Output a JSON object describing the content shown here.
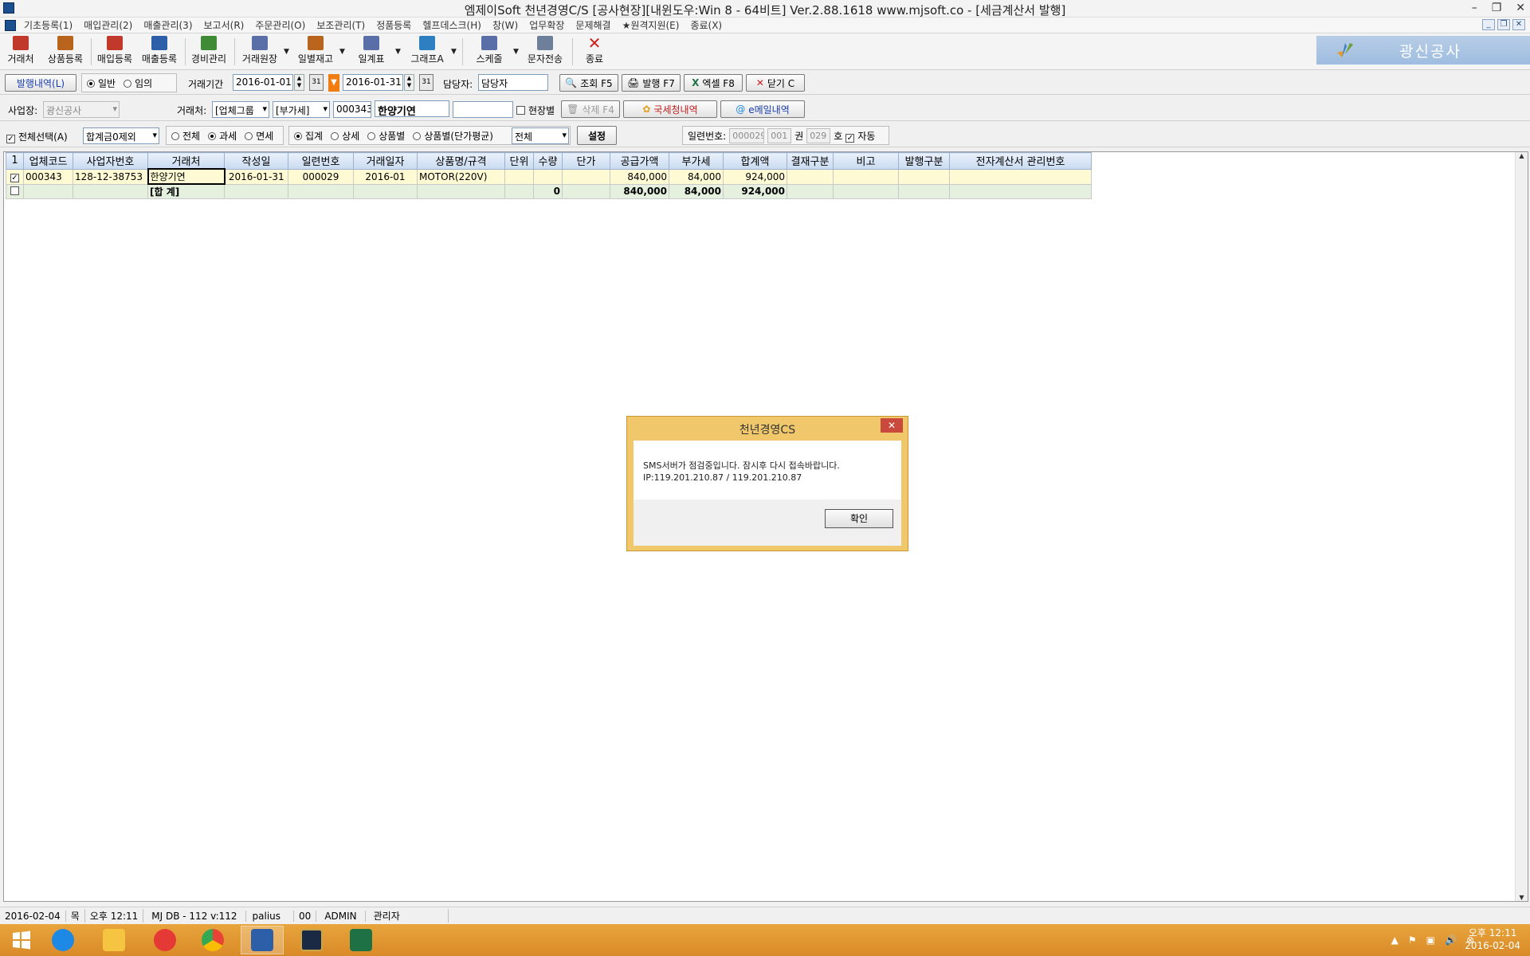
{
  "window": {
    "title": "엠제이Soft 천년경영C/S [공사현장][내윈도우:Win 8 - 64비트] Ver.2.88.1618          www.mjsoft.co - [세금계산서 발행]",
    "controls": [
      "–",
      "❐",
      "✕"
    ]
  },
  "menu": [
    "기초등록(1)",
    "매입관리(2)",
    "매출관리(3)",
    "보고서(R)",
    "주문관리(O)",
    "보조관리(T)",
    "정품등록",
    "헬프데스크(H)",
    "창(W)",
    "업무확장",
    "문제해결",
    "★원격지원(E)",
    "종료(X)"
  ],
  "mdi_controls": [
    "_",
    "❐",
    "✕"
  ],
  "toolbar": {
    "buttons": [
      {
        "label": "거래처",
        "color": "#c0392b"
      },
      {
        "label": "상품등록",
        "color": "#b8641c"
      },
      {
        "label": "매입등록",
        "color": "#c0392b"
      },
      {
        "label": "매출등록",
        "color": "#2d5fa8"
      },
      {
        "label": "경비관리",
        "color": "#3e8a35"
      },
      {
        "label": "거래원장",
        "color": "#5a6fa8"
      },
      {
        "label": "일별재고",
        "color": "#b8641c"
      },
      {
        "label": "일계표",
        "color": "#5a6fa8"
      },
      {
        "label": "그래프A",
        "color": "#2d7fc1"
      },
      {
        "label": "스케줄",
        "color": "#5a6fa8"
      },
      {
        "label": "문자전송",
        "color": "#6e7f9a"
      },
      {
        "label": "종료",
        "color": "#d02020"
      }
    ],
    "brand": "광신공사"
  },
  "row1": {
    "tab_label": "발행내역(L)",
    "radio_normal": "일반",
    "radio_custom": "임의",
    "period_label": "거래기간",
    "date_from": "2016-01-01",
    "date_to": "2016-01-31",
    "manager_label": "담당자:",
    "manager_value": "담당자",
    "search_btn": "조회 F5",
    "issue_btn": "발행 F7",
    "excel_btn": "엑셀 F8",
    "close_btn": "닫기 C"
  },
  "row2": {
    "site_label": "사업장:",
    "site_value": "광신공사",
    "client_label": "거래처:",
    "client_type": "[업체그룹",
    "tax_type": "[부가세]",
    "client_code": "000343",
    "client_name": "한양기연",
    "extra_value": "",
    "site_check": "현장별",
    "delete_btn": "삭제 F4",
    "nts_btn": "국세청내역",
    "email_btn": "e메일내역"
  },
  "row3": {
    "select_all": "전체선택(A)",
    "sum_option": "합계금0제외",
    "tax_all": "전체",
    "tax_taxable": "과세",
    "tax_exempt": "면세",
    "view_summary": "집계",
    "view_detail": "상세",
    "view_item": "상품별",
    "view_item_avg": "상품별(단가평균)",
    "view_filter": "전체",
    "settings_btn": "설정",
    "serial_label": "일련번호:",
    "serial_no": "000029",
    "book_no": "001",
    "book_label": "권",
    "issue_no": "029",
    "issue_label": "호",
    "auto_label": "자동"
  },
  "grid": {
    "headers": [
      "1",
      "업체코드",
      "사업자번호",
      "거래처",
      "작성일",
      "일련번호",
      "거래일자",
      "상품명/규격",
      "단위",
      "수량",
      "단가",
      "공급가액",
      "부가세",
      "합계액",
      "결재구분",
      "비고",
      "발행구분",
      "전자계산서 관리번호"
    ],
    "rows": [
      {
        "check": "✓",
        "code": "000343",
        "bizno": "128-12-38753",
        "client": "한양기연",
        "date": "2016-01-31",
        "serial": "000029",
        "tdate": "2016-01",
        "item": "MOTOR(220V)",
        "unit": "",
        "qty": "",
        "price": "",
        "supply": "840,000",
        "vat": "84,000",
        "total": "924,000",
        "pay": "",
        "note": "",
        "issue": "",
        "mgmt": ""
      }
    ],
    "sum": {
      "label": "[합 계]",
      "qty": "0",
      "supply": "840,000",
      "vat": "84,000",
      "total": "924,000"
    }
  },
  "dialog": {
    "title": "천년경영CS",
    "close": "✕",
    "message_line1": "SMS서버가 점검중입니다. 잠시후 다시 접속바랍니다.",
    "message_line2": "IP:119.201.210.87 / 119.201.210.87",
    "ok": "확인"
  },
  "status": [
    "2016-02-04",
    "목",
    "오후 12:11",
    "MJ DB - 112 v:112",
    "palius",
    "00",
    "ADMIN",
    "관리자"
  ],
  "taskbar": {
    "apps": [
      {
        "name": "start",
        "color": "#ffffff"
      },
      {
        "name": "ie",
        "color": "#1e88e5"
      },
      {
        "name": "explorer",
        "color": "#f5c542"
      },
      {
        "name": "app-red",
        "color": "#e53935"
      },
      {
        "name": "chrome",
        "color": "#34a853"
      },
      {
        "name": "mjsoft",
        "color": "#2d5fa8"
      },
      {
        "name": "lol",
        "color": "#1a2a44"
      },
      {
        "name": "excel",
        "color": "#1e7145"
      }
    ],
    "tray": [
      "▲",
      "⚑",
      "▣",
      "🔊",
      "⊗"
    ],
    "time": "오후 12:11",
    "date": "2016-02-04"
  }
}
